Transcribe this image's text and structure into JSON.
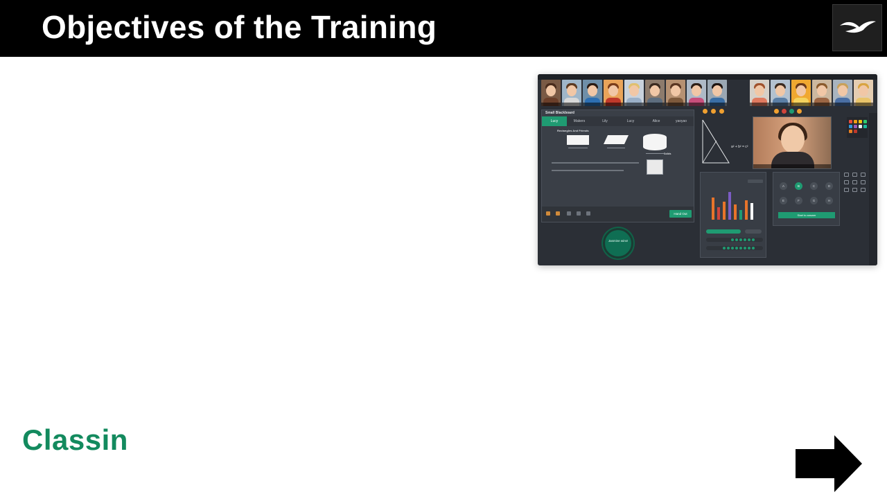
{
  "slide": {
    "title": "Objectives of the Training",
    "brand_logo_text": "Classin",
    "brand_color": "#138a5e",
    "header_color": "#000000"
  },
  "screenshot": {
    "blackboard": {
      "title": "Small Blackboard",
      "tabs": [
        "Lucy",
        "Makers",
        "Lily",
        "Lucy",
        "Alice",
        "yaoyao"
      ],
      "active_tab_index": 0,
      "heading": "Rectangles And Friends",
      "solids_heading": "Solids",
      "formula": "a² + b² = c²",
      "hand_out_label": "Hand Out"
    },
    "answer_circle_label": "Jasmine wins!",
    "selector": {
      "options": [
        "A",
        "B",
        "C",
        "D",
        "E",
        "F",
        "G",
        "H"
      ],
      "selected": "B",
      "start_label": "Start to answer"
    },
    "accent_color": "#1f9b72"
  },
  "icons": {
    "header_logo": "bird-logo-icon",
    "next": "right-arrow-icon"
  }
}
